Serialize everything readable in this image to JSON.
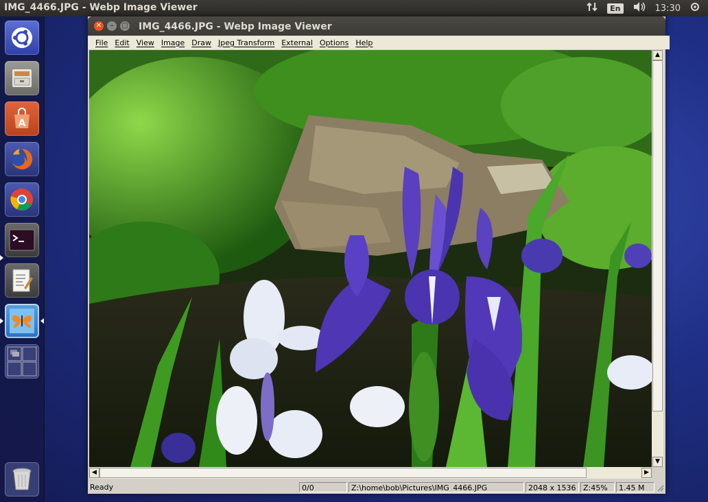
{
  "topbar": {
    "title": "IMG_4466.JPG - Webp Image Viewer",
    "lang": "En",
    "clock": "13:30"
  },
  "launcher": {
    "items": [
      {
        "name": "dash-home",
        "icon": "ubuntu-logo-icon"
      },
      {
        "name": "files",
        "icon": "file-cabinet-icon"
      },
      {
        "name": "software-center",
        "icon": "shopping-bag-icon"
      },
      {
        "name": "firefox",
        "icon": "firefox-icon"
      },
      {
        "name": "chromium",
        "icon": "chrome-icon"
      },
      {
        "name": "terminal",
        "icon": "terminal-icon"
      },
      {
        "name": "text-editor",
        "icon": "notepad-icon"
      },
      {
        "name": "webp-image-viewer",
        "icon": "butterfly-icon"
      },
      {
        "name": "workspace-switcher",
        "icon": "workspaces-icon"
      },
      {
        "name": "trash",
        "icon": "trash-icon"
      }
    ]
  },
  "window": {
    "title": "IMG_4466.JPG - Webp Image Viewer",
    "menu": [
      "File",
      "Edit",
      "View",
      "Image",
      "Draw",
      "Jpeg Transform",
      "External",
      "Options",
      "Help"
    ]
  },
  "status": {
    "state": "Ready",
    "frame": "0/0",
    "path": "Z:\\home\\bob\\Pictures\\IMG_4466.JPG",
    "dimensions": "2048 x 1536",
    "zoom": "Z:45%",
    "size": "1.45 M"
  },
  "colors": {
    "panel": "#3c3b37",
    "launcher_bg": "#141846",
    "iris_purple": "#4a2ea8",
    "foliage_green": "#3f8f1e"
  }
}
